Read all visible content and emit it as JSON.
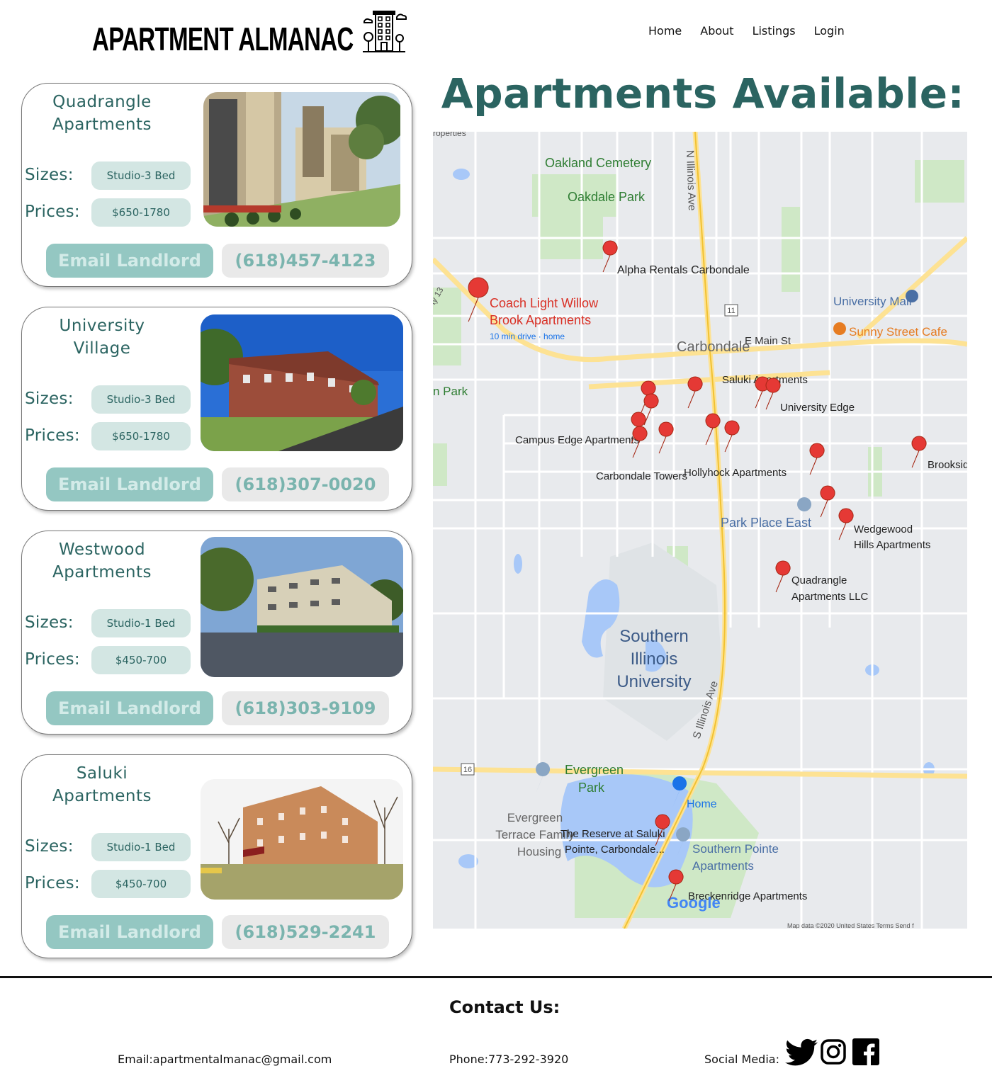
{
  "header": {
    "brand": "APARTMENT ALMANAC",
    "nav": [
      "Home",
      "About",
      "Listings",
      "Login"
    ]
  },
  "main": {
    "heading": "Apartments Available:"
  },
  "labels": {
    "sizes": "Sizes:",
    "prices": "Prices:",
    "email_button": "Email Landlord"
  },
  "listings": [
    {
      "name_line1": "Quadrangle",
      "name_line2": "Apartments",
      "sizes": "Studio-3 Bed",
      "prices": "$650-1780",
      "phone": "(618)457-4123"
    },
    {
      "name_line1": "University",
      "name_line2": "Village",
      "sizes": "Studio-3 Bed",
      "prices": "$650-1780",
      "phone": "(618)307-0020"
    },
    {
      "name_line1": "Westwood",
      "name_line2": "Apartments",
      "sizes": "Studio-1 Bed",
      "prices": "$450-700",
      "phone": "(618)303-9109"
    },
    {
      "name_line1": "Saluki",
      "name_line2": "Apartments",
      "sizes": "Studio-1 Bed",
      "prices": "$450-700",
      "phone": "(618)529-2241"
    }
  ],
  "map": {
    "labels": {
      "oakland": "Oakland Cemetery",
      "oakdale": "Oakdale Park",
      "n_illinois": "N Illinois Ave",
      "alpha": "Alpha Rentals Carbondale",
      "coach1": "Coach Light Willow",
      "coach2": "Brook Apartments",
      "coach3": "10 min drive · home",
      "carbondale": "Carbondale",
      "emain": "E Main St",
      "univ_mall": "University Mall",
      "sunny": "Sunny Street Cafe",
      "saluki": "Saluki Apartments",
      "univ_edge": "University Edge",
      "campus_edge": "Campus Edge Apartments",
      "towers": "Carbondale Towers",
      "hollyhock": "Hollyhock Apartments",
      "brookside": "Brooksid",
      "park_place": "Park Place East",
      "wedgewood1": "Wedgewood",
      "wedgewood2": "Hills Apartments",
      "quad1": "Quadrangle",
      "quad2": "Apartments LLC",
      "siu1": "Southern",
      "siu2": "Illinois",
      "siu3": "University",
      "s_illinois": "S Illinois Ave",
      "evergreen1": "Evergreen",
      "evergreen2": "Park",
      "terrace1": "Evergreen",
      "terrace2": "Terrace Family",
      "terrace3": "Housing",
      "reserve1": "The Reserve at Saluki",
      "reserve2": "Pointe, Carbondale...",
      "home": "Home",
      "sp1": "Southern Pointe",
      "sp2": "Apartments",
      "breckenridge": "Breckenridge Apartments",
      "google": "Google",
      "park_left": "n Park",
      "route13": "ty 13",
      "r11": "11",
      "r16": "16",
      "top_left": "roperties",
      "footer": "Map data ©2020   United States   Terms   Send f"
    }
  },
  "footer": {
    "title": "Contact Us:",
    "email": "Email:apartmentalmanac@gmail.com",
    "phone": "Phone:773-292-3920",
    "social": "Social Media:"
  },
  "colors": {
    "accent": "#2b6461",
    "pill": "#d3e6e3",
    "email_btn": "#94c7c2",
    "phone_btn": "#e9e9e9"
  }
}
